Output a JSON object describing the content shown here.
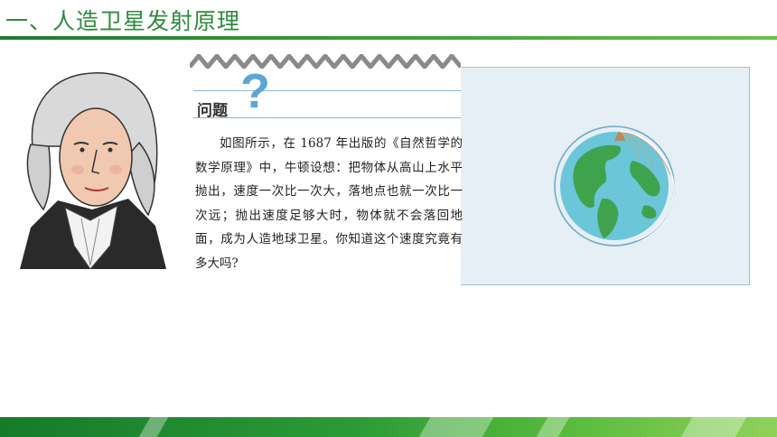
{
  "title": "一、人造卫星发射原理",
  "question": {
    "heading": "问题",
    "mark": "?",
    "text": "如图所示，在 1687 年出版的《自然哲学的数学原理》中，牛顿设想：把物体从高山上水平抛出，速度一次比一次大，落地点也就一次比一次远；抛出速度足够大时，物体就不会落回地面，成为人造地球卫星。你知道这个速度究竟有多大吗?"
  },
  "colors": {
    "title_green": "#2e8b3d",
    "panel_bg": "#e6eff6",
    "question_blue": "#5aa6d6"
  }
}
